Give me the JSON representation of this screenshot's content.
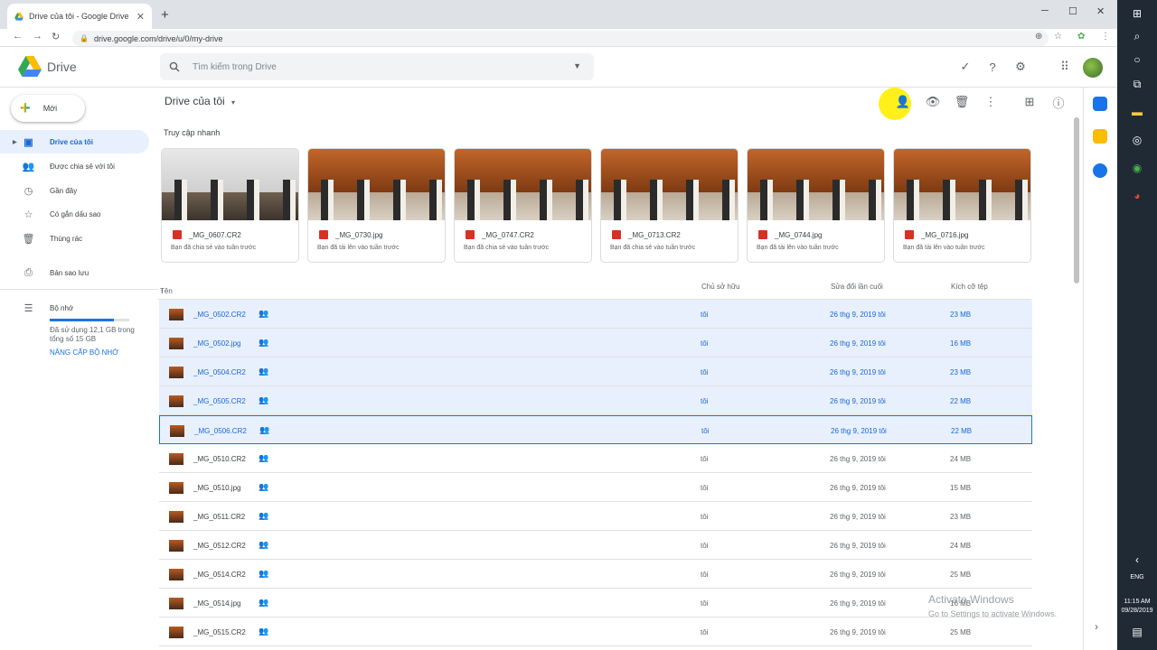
{
  "browser": {
    "tab_title": "Drive của tôi - Google Drive",
    "tab_close": "✕",
    "new_tab": "+",
    "win_min": "─",
    "win_max": "☐",
    "win_close": "✕",
    "url": "drive.google.com/drive/u/0/my-drive",
    "back": "←",
    "forward": "→",
    "reload": "↻"
  },
  "header": {
    "app_name": "Drive",
    "search_placeholder": "Tìm kiếm trong Drive"
  },
  "sidebar": {
    "new_label": "Mới",
    "items": [
      {
        "label": "Drive của tôi",
        "icon": "drive-folder-icon"
      },
      {
        "label": "Được chia sẻ với tôi",
        "icon": "people-icon"
      },
      {
        "label": "Gần đây",
        "icon": "clock-icon"
      },
      {
        "label": "Có gắn dấu sao",
        "icon": "star-icon"
      },
      {
        "label": "Thùng rác",
        "icon": "trash-icon"
      },
      {
        "label": "Bản sao lưu",
        "icon": "backup-icon"
      },
      {
        "label": "Bộ nhớ",
        "icon": "storage-icon"
      }
    ],
    "storage_text": "Đã sử dụng 12,1 GB trong tổng số 15 GB",
    "storage_used_fraction": 0.81,
    "upgrade": "NÂNG CẤP BỘ NHỚ"
  },
  "main": {
    "breadcrumb": "Drive của tôi",
    "breadcrumb_caret": "▾",
    "quick_access_title": "Truy cập nhanh",
    "quick_access": [
      {
        "name": "_MG_0607.CR2",
        "sub": "Bạn đã chia sẻ vào tuần trước",
        "style": "room"
      },
      {
        "name": "_MG_0730.jpg",
        "sub": "Bạn đã tải lên vào tuần trước",
        "style": "ceremony"
      },
      {
        "name": "_MG_0747.CR2",
        "sub": "Bạn đã chia sẻ vào tuần trước",
        "style": "ceremony"
      },
      {
        "name": "_MG_0713.CR2",
        "sub": "Bạn đã chia sẻ vào tuần trước",
        "style": "ceremony"
      },
      {
        "name": "_MG_0744.jpg",
        "sub": "Bạn đã tải lên vào tuần trước",
        "style": "ceremony"
      },
      {
        "name": "_MG_0716.jpg",
        "sub": "Bạn đã tải lên vào tuần trước",
        "style": "ceremony"
      }
    ],
    "columns": {
      "name": "Tên",
      "sort_arrow": "↑",
      "owner": "Chủ sở hữu",
      "modified": "Sửa đổi lần cuối",
      "size": "Kích cỡ tệp"
    },
    "files": [
      {
        "name": "_MG_0502.CR2",
        "owner": "tôi",
        "modified": "26 thg 9, 2019 tôi",
        "size": "23 MB",
        "selected": true
      },
      {
        "name": "_MG_0502.jpg",
        "owner": "tôi",
        "modified": "26 thg 9, 2019 tôi",
        "size": "16 MB",
        "selected": true
      },
      {
        "name": "_MG_0504.CR2",
        "owner": "tôi",
        "modified": "26 thg 9, 2019 tôi",
        "size": "23 MB",
        "selected": true
      },
      {
        "name": "_MG_0505.CR2",
        "owner": "tôi",
        "modified": "26 thg 9, 2019 tôi",
        "size": "22 MB",
        "selected": true
      },
      {
        "name": "_MG_0506.CR2",
        "owner": "tôi",
        "modified": "26 thg 9, 2019 tôi",
        "size": "22 MB",
        "selected": true
      },
      {
        "name": "_MG_0510.CR2",
        "owner": "tôi",
        "modified": "26 thg 9, 2019 tôi",
        "size": "24 MB",
        "selected": false
      },
      {
        "name": "_MG_0510.jpg",
        "owner": "tôi",
        "modified": "26 thg 9, 2019 tôi",
        "size": "15 MB",
        "selected": false
      },
      {
        "name": "_MG_0511.CR2",
        "owner": "tôi",
        "modified": "26 thg 9, 2019 tôi",
        "size": "23 MB",
        "selected": false
      },
      {
        "name": "_MG_0512.CR2",
        "owner": "tôi",
        "modified": "26 thg 9, 2019 tôi",
        "size": "24 MB",
        "selected": false
      },
      {
        "name": "_MG_0514.CR2",
        "owner": "tôi",
        "modified": "26 thg 9, 2019 tôi",
        "size": "25 MB",
        "selected": false
      },
      {
        "name": "_MG_0514.jpg",
        "owner": "tôi",
        "modified": "26 thg 9, 2019 tôi",
        "size": "16 MB",
        "selected": false
      },
      {
        "name": "_MG_0515.CR2",
        "owner": "tôi",
        "modified": "26 thg 9, 2019 tôi",
        "size": "25 MB",
        "selected": false
      }
    ]
  },
  "watermark": {
    "line1": "Activate Windows",
    "line2": "Go to Settings to activate Windows."
  },
  "taskbar": {
    "lang": "ENG",
    "time": "11:15 AM",
    "date": "09/28/2019"
  },
  "colors": {
    "accent": "#1a73e8",
    "selected_bg": "#e8f0fe",
    "cursor_highlight": "#ffee00"
  }
}
